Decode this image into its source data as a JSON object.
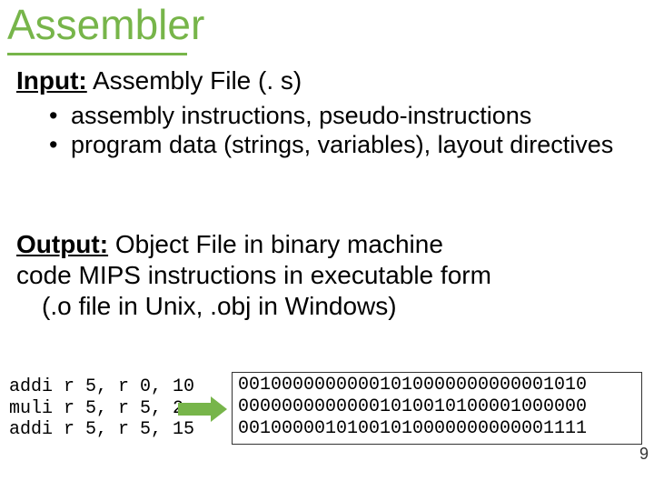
{
  "title": "Assembler",
  "input": {
    "label": "Input:",
    "text": " Assembly File (. s)",
    "bullets": [
      "assembly instructions, pseudo-instructions",
      "program data (strings, variables), layout directives"
    ]
  },
  "output": {
    "label": "Output:",
    "line1_rest": "  Object File in binary machine",
    "line2": "code  MIPS instructions in executable form",
    "line3": "(.o file in Unix, .obj in Windows)"
  },
  "asm": {
    "l1": "addi r 5, r 0, 10",
    "l2": "muli r 5, r 5, 2",
    "l3": "addi r 5, r 5, 15"
  },
  "bin": {
    "l1": "00100000000001010000000000001010",
    "l2": "00000000000001010010100001000000",
    "l3": "00100000101001010000000000001111"
  },
  "page": "9",
  "bullet_dot": "•"
}
